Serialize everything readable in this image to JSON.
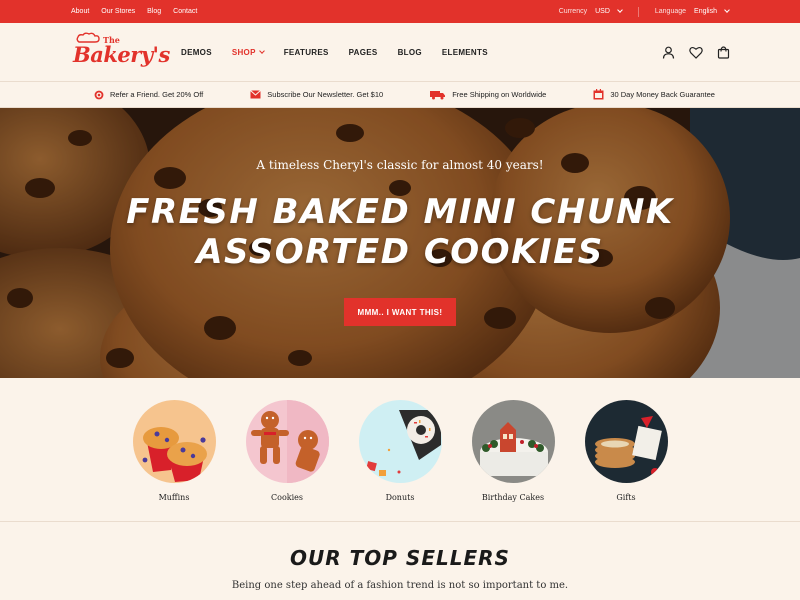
{
  "topbar": {
    "links": [
      "About",
      "Our Stores",
      "Blog",
      "Contact"
    ],
    "currency_label": "Currency",
    "currency_value": "USD",
    "language_label": "Language",
    "language_value": "English"
  },
  "header": {
    "logo_the": "The",
    "logo_name": "Bakery's",
    "nav": [
      "DEMOS",
      "SHOP",
      "FEATURES",
      "PAGES",
      "BLOG",
      "ELEMENTS"
    ],
    "active_nav": "SHOP"
  },
  "promos": [
    {
      "icon": "target-icon",
      "text": "Refer a Friend. Get 20% Off"
    },
    {
      "icon": "mail-icon",
      "text": "Subscribe Our Newsletter. Get $10"
    },
    {
      "icon": "truck-icon",
      "text": "Free Shipping on Worldwide"
    },
    {
      "icon": "calendar-icon",
      "text": "30 Day  Money Back Guarantee"
    }
  ],
  "hero": {
    "tagline": "A timeless Cheryl's classic for almost 40 years!",
    "title_line1": "Fresh Baked Mini Chunk",
    "title_line2": "Assorted Cookies",
    "cta": "MMM.. I WANT THIS!"
  },
  "categories": [
    {
      "label": "Muffins"
    },
    {
      "label": "Cookies"
    },
    {
      "label": "Donuts"
    },
    {
      "label": "Birthday Cakes"
    },
    {
      "label": "Gifts"
    }
  ],
  "sellers": {
    "title": "OUR TOP SELLERS",
    "subtitle": "Being one step ahead of a fashion trend is not so important to me."
  },
  "colors": {
    "accent": "#e2322b",
    "cream": "#fbf3ea"
  }
}
